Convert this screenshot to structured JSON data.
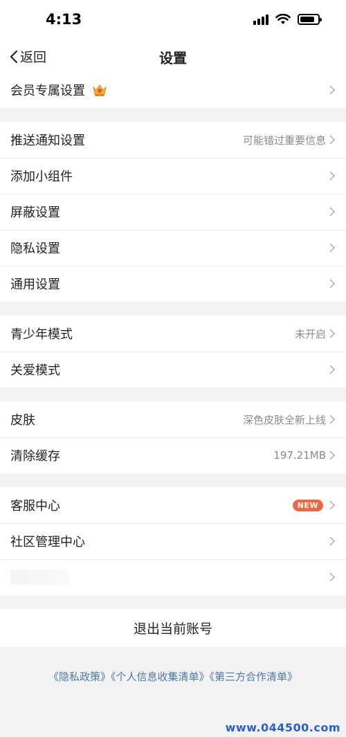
{
  "status_bar": {
    "time": "4:13"
  },
  "nav": {
    "back_label": "返回",
    "title": "设置"
  },
  "groups": [
    {
      "rows": [
        {
          "label": "会员专属设置",
          "value": "",
          "badge": ""
        }
      ]
    },
    {
      "rows": [
        {
          "label": "推送通知设置",
          "value": "可能错过重要信息"
        },
        {
          "label": "添加小组件",
          "value": ""
        },
        {
          "label": "屏蔽设置",
          "value": ""
        },
        {
          "label": "隐私设置",
          "value": ""
        },
        {
          "label": "通用设置",
          "value": ""
        }
      ]
    },
    {
      "rows": [
        {
          "label": "青少年模式",
          "value": "未开启"
        },
        {
          "label": "关爱模式",
          "value": ""
        }
      ]
    },
    {
      "rows": [
        {
          "label": "皮肤",
          "value": "深色皮肤全新上线"
        },
        {
          "label": "清除缓存",
          "value": "197.21MB"
        }
      ]
    },
    {
      "rows": [
        {
          "label": "客服中心",
          "badge": "NEW"
        },
        {
          "label": "社区管理中心",
          "value": ""
        },
        {
          "label": "",
          "value": ""
        }
      ]
    }
  ],
  "logout_label": "退出当前账号",
  "footer_links": [
    "《隐私政策》",
    "《个人信息收集清单》",
    "《第三方合作清单》"
  ],
  "watermark": "www.044500.com",
  "colors": {
    "accent_badge": "#f0663f",
    "link": "#4a79a8",
    "background": "#f2f2f2"
  }
}
